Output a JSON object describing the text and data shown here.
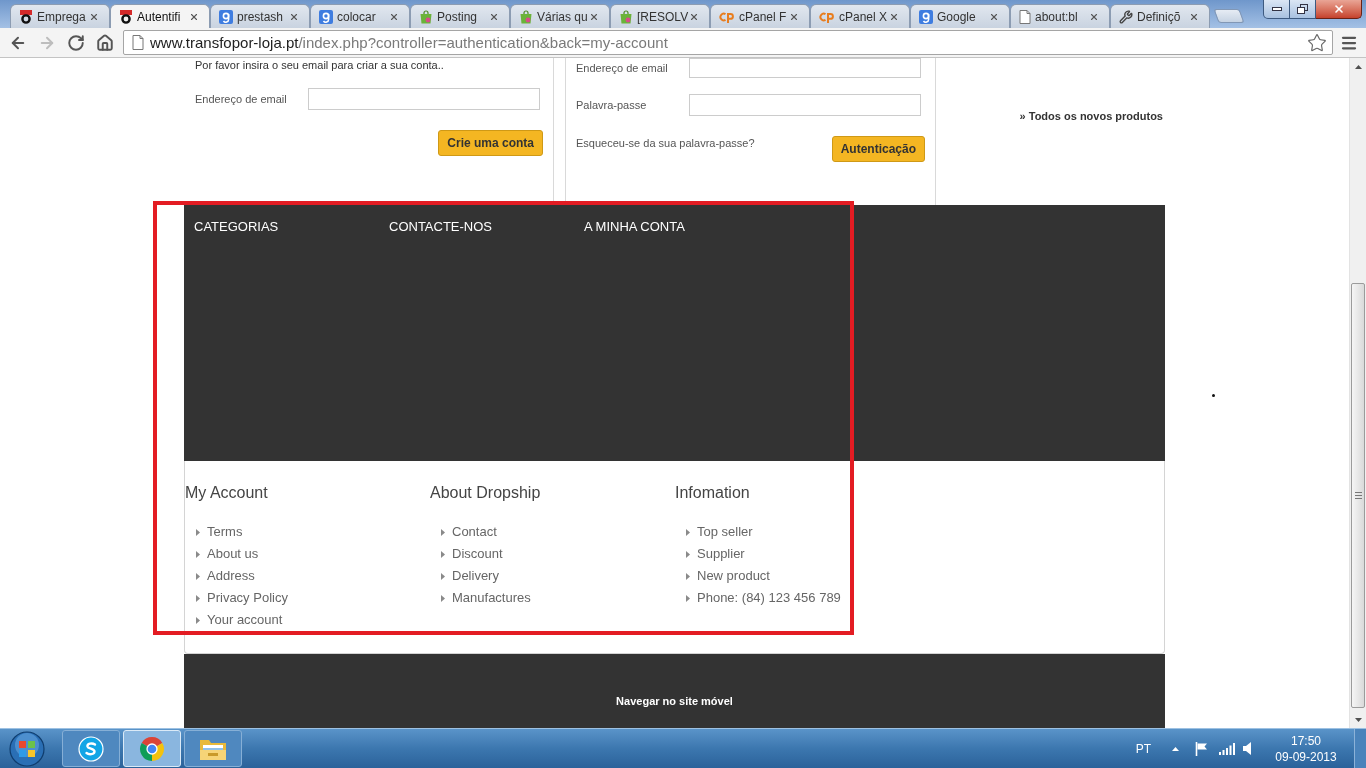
{
  "window": {
    "tabs": [
      {
        "title": "Emprega",
        "kind": "ring",
        "selected": false
      },
      {
        "title": "Autentifi",
        "kind": "ring",
        "selected": true
      },
      {
        "title": "prestash",
        "kind": "g",
        "selected": false
      },
      {
        "title": "colocar",
        "kind": "g",
        "selected": false
      },
      {
        "title": "Posting",
        "kind": "bag",
        "selected": false
      },
      {
        "title": "Várias qu",
        "kind": "bag",
        "selected": false
      },
      {
        "title": "[RESOLV",
        "kind": "bag",
        "selected": false
      },
      {
        "title": "cPanel F",
        "kind": "cp",
        "selected": false
      },
      {
        "title": "cPanel X",
        "kind": "cp",
        "selected": false
      },
      {
        "title": "Google",
        "kind": "g",
        "selected": false
      },
      {
        "title": "about:bl",
        "kind": "page",
        "selected": false
      },
      {
        "title": "Definiçõ",
        "kind": "wrench",
        "selected": false
      }
    ]
  },
  "toolbar": {
    "nav": [
      {
        "kind": "back",
        "disabled": false
      },
      {
        "kind": "forward",
        "disabled": true
      },
      {
        "kind": "reload",
        "disabled": false
      },
      {
        "kind": "home",
        "disabled": false
      }
    ],
    "address": {
      "host": "www.transfopor-loja.pt",
      "path": "/index.php?controller=authentication&back=my-account"
    }
  },
  "create_account": {
    "intro": "Por favor insira o seu email para criar a sua conta..",
    "email_label": "Endereço de email",
    "button": "Crie uma conta"
  },
  "login": {
    "email_label": "Endereço de email",
    "password_label": "Palavra-passe",
    "forgot_link": "Esqueceu-se da sua palavra-passe?",
    "button": "Autenticação"
  },
  "side_link": "» Todos os novos produtos",
  "footer_top": {
    "headings": [
      "CATEGORIAS",
      "CONTACTE-NOS",
      "A MINHA CONTA"
    ]
  },
  "footer_links": {
    "columns": [
      {
        "heading": "My Account",
        "links": [
          "Terms",
          "About us",
          "Address",
          "Privacy Policy",
          "Your account"
        ]
      },
      {
        "heading": "About Dropship",
        "links": [
          "Contact",
          "Discount",
          "Delivery",
          "Manufactures"
        ]
      },
      {
        "heading": "Infomation",
        "links": [
          "Top seller",
          "Supplier",
          "New product",
          "Phone: (84) 123 456 789"
        ]
      }
    ]
  },
  "footer_bottom": {
    "mobile_link": "Navegar no site móvel"
  },
  "taskbar": {
    "apps": [
      {
        "kind": "skype",
        "active": false
      },
      {
        "kind": "chrome",
        "active": true
      },
      {
        "kind": "explorer",
        "active": false
      }
    ],
    "language": "PT",
    "time": "17:50",
    "date": "09-09-2013"
  }
}
